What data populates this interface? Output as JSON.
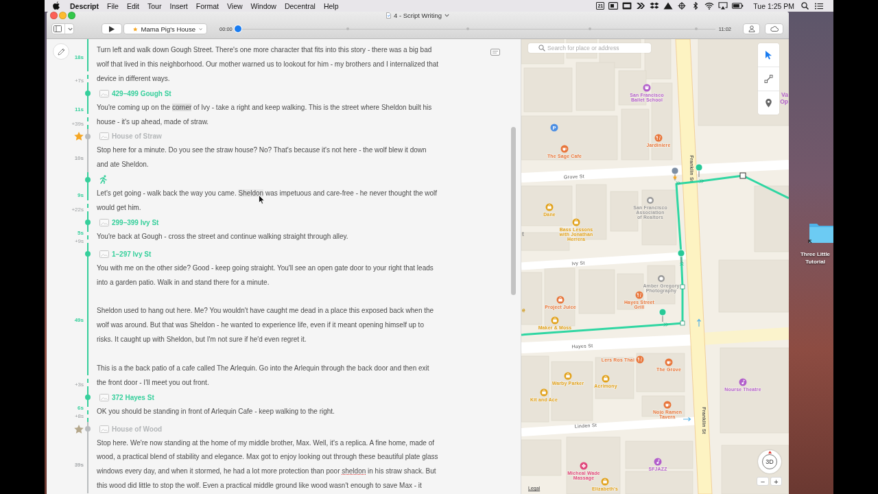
{
  "menu_bar": {
    "app_name": "Descript",
    "menus": [
      "File",
      "Edit",
      "Tour",
      "Insert",
      "Format",
      "View",
      "Window",
      "Decentral",
      "Help"
    ],
    "calendar_day": "21",
    "clock": "Tue 1:25 PM"
  },
  "window": {
    "title": "4 - Script Writing",
    "toolbar": {
      "location": "Mama Pig's House",
      "time_start": "00:00",
      "time_end": "11:02",
      "playhead": {
        "level": 0
      }
    }
  },
  "script": {
    "sections": [
      {
        "kind": "continued",
        "starred": false,
        "has_comment": true,
        "duration": "18s",
        "transition": "+7s",
        "paragraphs": [
          {
            "text": "Turn left and walk down Gough Street. There's one more character that fits into this story - there was a big bad wolf that lived in this neighborhood. Our mother warned us to lookout for him - my brothers and I internalized that device in different ways."
          }
        ]
      },
      {
        "kind": "route",
        "title": "429–499 Gough St",
        "starred": false,
        "has_comment": false,
        "duration": "11s",
        "transition": "+39s",
        "paragraphs": [
          {
            "segments": [
              {
                "kind": "plain",
                "text": "You're coming up on the "
              },
              {
                "kind": "selected",
                "text": "corner"
              },
              {
                "kind": "plain",
                "text": " of Ivy - take a right and keep walking. This is the street where Sheldon built his house - it's up ahead, made of straw."
              }
            ]
          }
        ]
      },
      {
        "kind": "landmark",
        "title": "House of Straw",
        "starred": true,
        "star": {
          "color": "#f5a623"
        },
        "has_comment": false,
        "duration": "10s",
        "paragraphs": [
          {
            "text": "Stop here for a minute. Do you see the straw house? No? That's because it's not here - the wolf blew it down and ate Sheldon."
          }
        ]
      },
      {
        "kind": "walk",
        "starred": false,
        "has_comment": false,
        "duration": "9s",
        "transition": "+22s",
        "paragraphs": [
          {
            "segments": [
              {
                "kind": "plain",
                "text": "Let's get going - walk back the way you came. "
              },
              {
                "kind": "hovered",
                "text": "Sheldon"
              },
              {
                "kind": "plain",
                "text": " was impetuous and care-free - he never thought the wolf would get him."
              }
            ]
          }
        ]
      },
      {
        "kind": "route",
        "title": "299–399 Ivy St",
        "starred": false,
        "has_comment": false,
        "duration": "5s",
        "transition": "+9s",
        "paragraphs": [
          {
            "text": "You're back at Gough - cross the street and continue walking straight through alley."
          }
        ]
      },
      {
        "kind": "route",
        "title": "1–297 Ivy St",
        "starred": false,
        "has_comment": false,
        "duration": "49s",
        "transition": "+3s",
        "paragraphs": [
          {
            "text": "You with me on the other side? Good - keep going straight. You'll see an open gate door to your right that leads into a garden patio. Walk in and stand there for a minute."
          },
          {
            "text": "Sheldon used to hang out here. Me? You wouldn't have caught me dead in a place this exposed back when the wolf was around. But that was Sheldon - he wanted to experience life, even if it meant opening himself up to risks. It caught up with Sheldon, but I'm not sure if he'd even regret it."
          },
          {
            "text": "This is a the back patio of a cafe called The Arlequin. Go into the Arlequin through the back door and then exit the front door - I'll meet you out front."
          }
        ]
      },
      {
        "kind": "route",
        "title": "372 Hayes St",
        "starred": false,
        "has_comment": false,
        "duration": "6s",
        "transition": "+8s",
        "paragraphs": [
          {
            "text": "OK you should be standing in front of Arlequin Cafe - keep walking to the right."
          }
        ]
      },
      {
        "kind": "landmark",
        "title": "House of Wood",
        "starred": true,
        "star": {
          "color": "#b4a78b"
        },
        "has_comment": false,
        "duration": "39s",
        "paragraphs": [
          {
            "segments": [
              {
                "kind": "plain",
                "text": "Stop here. We're now standing at the home of my middle brother, Max. Well, it's a replica. A fine home, made of wood, a practical blend of stability and elegance. Max got to enjoy looking out through these beautiful plate glass windows every day, and when it stormed, he had a lot more protection than poor "
              },
              {
                "kind": "misspelled",
                "text": "sheldon"
              },
              {
                "kind": "plain",
                "text": " in his straw shack. But this wood did little to stop the wolf. Even a practical middle ground like wood wasn't enough to save Max - it"
              }
            ]
          }
        ]
      }
    ]
  },
  "map": {
    "search": {
      "placeholder": "Search for place or address"
    },
    "tools": [
      {
        "kind": "select",
        "selected": true
      },
      {
        "kind": "route",
        "selected": false
      },
      {
        "kind": "pin",
        "selected": false
      }
    ],
    "street_labels": [
      "Grove St",
      "Franklin St",
      "Ivy St",
      "Hayes St",
      "Linden St",
      "Franklin St"
    ],
    "places": [
      {
        "kind": "arts",
        "lines": [
          "San Francisco",
          "Ballet School"
        ],
        "color": "#b25ecb"
      },
      {
        "kind": "parking",
        "symbol": "P",
        "color": "#4d8fe3"
      },
      {
        "kind": "restaurant",
        "lines": [
          "Jardiniere"
        ],
        "color": "#e8753a"
      },
      {
        "kind": "cafe",
        "lines": [
          "The Sage Cafe"
        ],
        "color": "#e8753a"
      },
      {
        "kind": "shop",
        "lines": [
          "Dane"
        ],
        "color": "#e2a21b"
      },
      {
        "kind": "shop",
        "lines": [
          "Bass Lessons",
          "with Jonathan",
          "Herrera"
        ],
        "color": "#e2a21b"
      },
      {
        "kind": "place",
        "lines": [
          "San Francisco",
          "Association",
          "of Realtors"
        ],
        "color": "#9a9a9a"
      },
      {
        "kind": "place",
        "lines": [
          "Amber Gregory",
          "Photography"
        ],
        "color": "#9a9a9a"
      },
      {
        "kind": "shop",
        "lines": [
          "Project Juice"
        ],
        "color": "#e8753a"
      },
      {
        "kind": "restaurant",
        "lines": [
          "Hayes Street",
          "Grill"
        ],
        "color": "#e8753a"
      },
      {
        "kind": "shop",
        "lines": [
          "Maker & Moss"
        ],
        "color": "#e2a21b"
      },
      {
        "kind": "restaurant",
        "lines": [
          "Lers Ros Thai"
        ],
        "color": "#e8753a"
      },
      {
        "kind": "cafe",
        "lines": [
          "The Grove"
        ],
        "color": "#e8753a"
      },
      {
        "kind": "shop",
        "lines": [
          "Warby Parker"
        ],
        "color": "#e2a21b"
      },
      {
        "kind": "shop",
        "lines": [
          "Acrimony"
        ],
        "color": "#e2a21b"
      },
      {
        "kind": "shop",
        "lines": [
          "Kit and Ace"
        ],
        "color": "#e2a21b"
      },
      {
        "kind": "music",
        "lines": [
          "Nourse Theatre"
        ],
        "color": "#b25ecb"
      },
      {
        "kind": "cafe",
        "lines": [
          "Nojo Ramen",
          "Tavern"
        ],
        "color": "#e8753a"
      },
      {
        "kind": "music",
        "lines": [
          "SFJAZZ"
        ],
        "color": "#b25ecb"
      },
      {
        "kind": "spa",
        "lines": [
          "Micheal Wade",
          "Massage"
        ],
        "color": "#e0487c"
      },
      {
        "kind": "shop",
        "lines": [
          "Elizabeth's"
        ],
        "color": "#e2a21b"
      },
      {
        "kind": "fragment",
        "lines": [
          "t"
        ],
        "color": "#8a8a8a"
      },
      {
        "kind": "fragment",
        "lines": [
          "e"
        ],
        "color": "#d09a1c"
      },
      {
        "kind": "fragment",
        "lines": [
          "Va",
          "Op"
        ],
        "color": "#b25ecb"
      }
    ],
    "pins": [
      {
        "kind": "landmark"
      },
      {
        "kind": "stop"
      },
      {
        "kind": "stop"
      },
      {
        "kind": "stop"
      }
    ],
    "compass": "3D",
    "zoom_out": "−",
    "zoom_in": "+",
    "legal": "Legal"
  },
  "desktop": {
    "folder_label": [
      "Three Little",
      "Tutorial"
    ]
  }
}
